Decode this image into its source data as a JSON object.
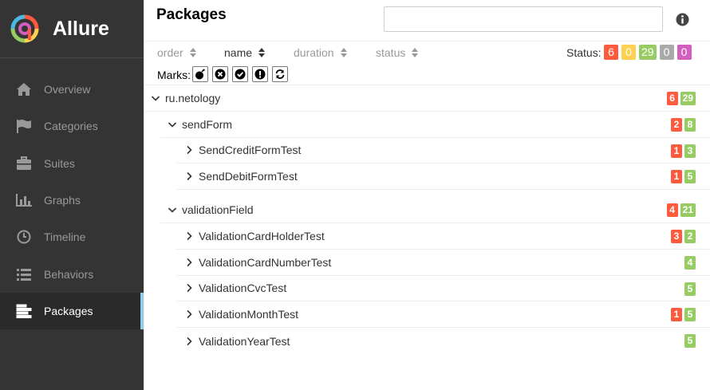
{
  "app": {
    "name": "Allure"
  },
  "colors": {
    "failed": "#fd5a3e",
    "broken": "#ffd050",
    "passed": "#97cc64",
    "skipped": "#aaaaaa",
    "unknown": "#d35ebe"
  },
  "sidebar": {
    "items": [
      {
        "label": "Overview",
        "icon": "home-icon"
      },
      {
        "label": "Categories",
        "icon": "flag-icon"
      },
      {
        "label": "Suites",
        "icon": "briefcase-icon"
      },
      {
        "label": "Graphs",
        "icon": "bar-chart-icon"
      },
      {
        "label": "Timeline",
        "icon": "clock-icon"
      },
      {
        "label": "Behaviors",
        "icon": "list-icon"
      },
      {
        "label": "Packages",
        "icon": "align-left-icon"
      }
    ]
  },
  "header": {
    "title": "Packages",
    "search_value": ""
  },
  "sort": {
    "order": "order",
    "name": "name",
    "duration": "duration",
    "status": "status"
  },
  "status": {
    "label": "Status:",
    "failed": "6",
    "broken": "0",
    "passed": "29",
    "skipped": "0",
    "unknown": "0"
  },
  "marks": {
    "label": "Marks:",
    "items": [
      "flaky-icon",
      "new-failed-icon",
      "new-passed-icon",
      "new-broken-icon",
      "retries-status-change-icon"
    ]
  },
  "tree": {
    "root": {
      "name": "ru.netology",
      "failed": "6",
      "passed": "29"
    },
    "groups": [
      {
        "name": "sendForm",
        "failed": "2",
        "passed": "8",
        "items": [
          {
            "name": "SendCreditFormTest",
            "failed": "1",
            "passed": "3"
          },
          {
            "name": "SendDebitFormTest",
            "failed": "1",
            "passed": "5"
          }
        ]
      },
      {
        "name": "validationField",
        "failed": "4",
        "passed": "21",
        "items": [
          {
            "name": "ValidationCardHolderTest",
            "failed": "3",
            "passed": "2"
          },
          {
            "name": "ValidationCardNumberTest",
            "passed": "4"
          },
          {
            "name": "ValidationCvcTest",
            "passed": "5"
          },
          {
            "name": "ValidationMonthTest",
            "failed": "1",
            "passed": "5"
          },
          {
            "name": "ValidationYearTest",
            "passed": "5"
          }
        ]
      }
    ]
  }
}
